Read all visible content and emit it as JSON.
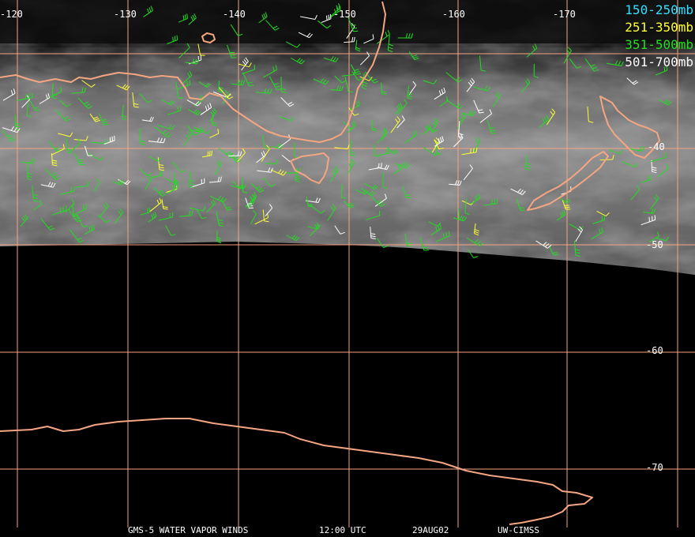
{
  "legend": [
    {
      "label": "150-250mb",
      "color": "#33e0ff"
    },
    {
      "label": "251-350mb",
      "color": "#ffff33"
    },
    {
      "label": "351-500mb",
      "color": "#22dd22"
    },
    {
      "label": "501-700mb",
      "color": "#ffffff"
    }
  ],
  "longitude_labels": [
    "-120",
    "-130",
    "-140",
    "-150",
    "-160",
    "-170"
  ],
  "latitude_labels": [
    "-40",
    "-50",
    "-60",
    "-70"
  ],
  "footer": {
    "product": "GMS-5 WATER VAPOR WINDS",
    "time": "12:00 UTC",
    "date": "29AUG02",
    "source": "UW-CIMSS"
  },
  "colors": {
    "coastline": "#f4a582",
    "gridline": "#f4a582",
    "background": "#000000"
  }
}
